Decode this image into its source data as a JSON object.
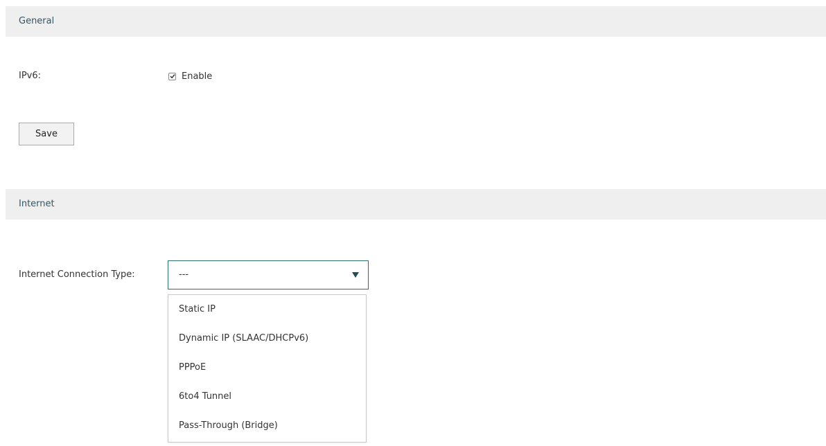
{
  "general": {
    "header": "General",
    "ipv6_label": "IPv6:",
    "enable_label": "Enable",
    "enable_checked": true,
    "save_label": "Save"
  },
  "internet": {
    "header": "Internet",
    "connection_type_label": "Internet Connection Type:",
    "selected_value": "---",
    "options": [
      "Static IP",
      "Dynamic IP (SLAAC/DHCPv6)",
      "PPPoE",
      "6to4 Tunnel",
      "Pass-Through (Bridge)"
    ]
  },
  "icons": {
    "checkbox": "checkmark-icon",
    "select_arrow": "triangle-down-icon"
  },
  "colors": {
    "header_bg": "#efefef",
    "header_text": "#335566",
    "select_border": "#2d6e6e",
    "arrow": "#214e5a"
  }
}
